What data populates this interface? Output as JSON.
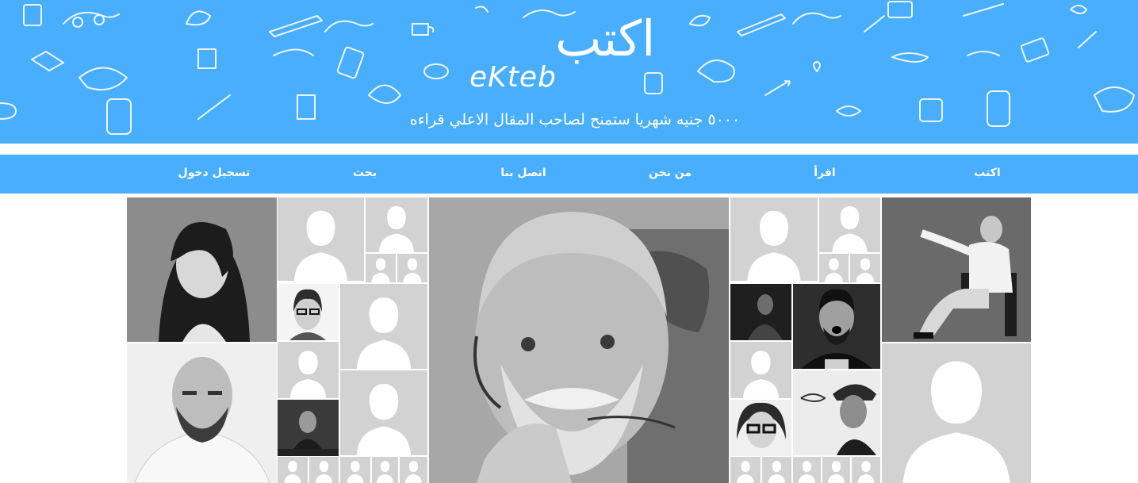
{
  "banner": {
    "logo_arabic": "اكتب",
    "logo_latin": "eKteb",
    "tagline": "٥٠٠٠ جنيه شهريا ستمنح لصاحب المقال الاعلي قراءه"
  },
  "nav": {
    "items": [
      {
        "label": "اكتب"
      },
      {
        "label": "اقرأ"
      },
      {
        "label": "من نحن"
      },
      {
        "label": "اتصل بنا"
      },
      {
        "label": "بحث"
      },
      {
        "label": "تسجيل دخول"
      }
    ]
  },
  "colors": {
    "brand_blue": "#4aaeff",
    "placeholder_gray": "#d2d2d2"
  },
  "writers_grid": {
    "icon": "writer-avatar"
  }
}
